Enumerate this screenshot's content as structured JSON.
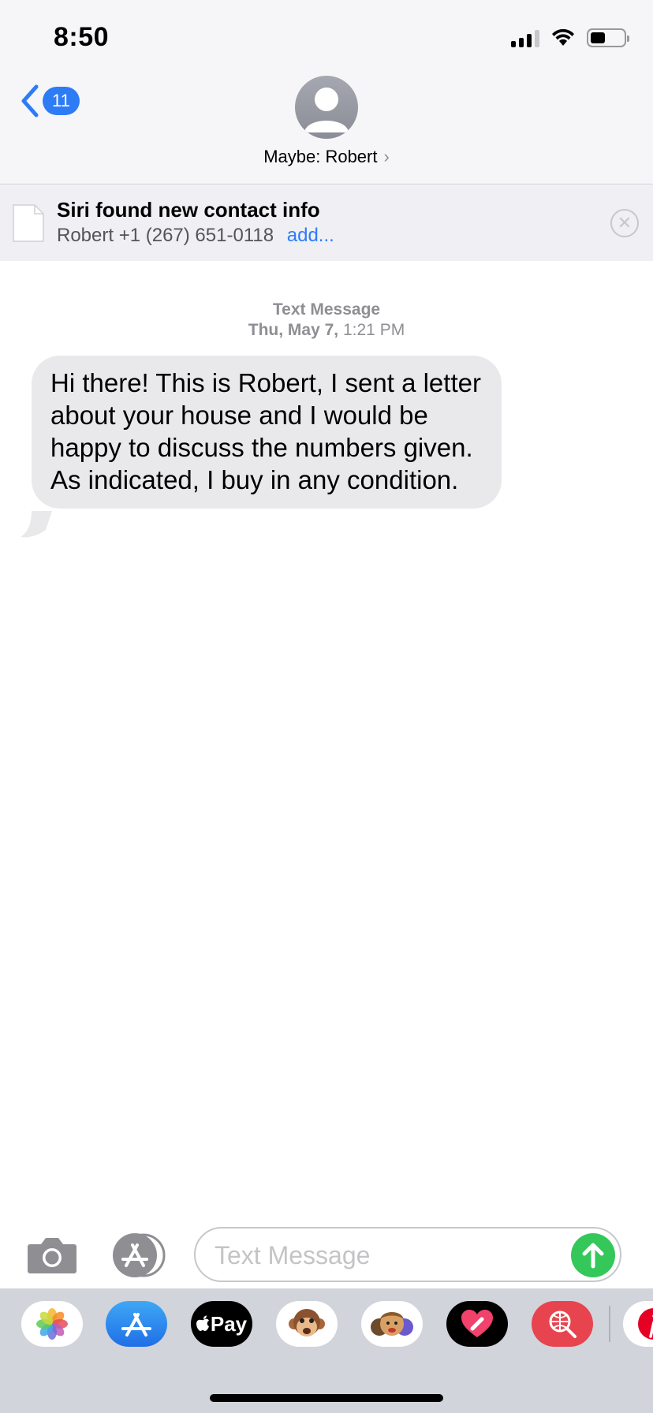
{
  "status_bar": {
    "time": "8:50"
  },
  "nav": {
    "back_count": "11",
    "contact_name": "Maybe: Robert",
    "contact_chevron": "›"
  },
  "siri_banner": {
    "title": "Siri found new contact info",
    "details": "Robert +1 (267) 651-0118",
    "add_label": "add..."
  },
  "conversation": {
    "service_label": "Text Message",
    "date": "Thu, May 7,",
    "time": "1:21 PM",
    "messages": [
      {
        "direction": "incoming",
        "text": "Hi there! This is Robert, I sent a letter about your house and I would be happy to discuss the numbers given. As indicated, I buy in any condition."
      }
    ]
  },
  "composer": {
    "placeholder": "Text Message"
  },
  "app_drawer": {
    "apps": [
      {
        "name": "photos-app-icon"
      },
      {
        "name": "app-store-icon"
      },
      {
        "name": "apple-pay-icon",
        "label": "Pay"
      },
      {
        "name": "animoji-icon"
      },
      {
        "name": "memoji-stickers-icon"
      },
      {
        "name": "digital-touch-icon"
      },
      {
        "name": "images-search-icon"
      },
      {
        "name": "pinterest-icon"
      }
    ]
  },
  "colors": {
    "accent_blue": "#2d7cf6",
    "bubble_gray": "#e9e9eb",
    "send_green": "#34c759"
  }
}
